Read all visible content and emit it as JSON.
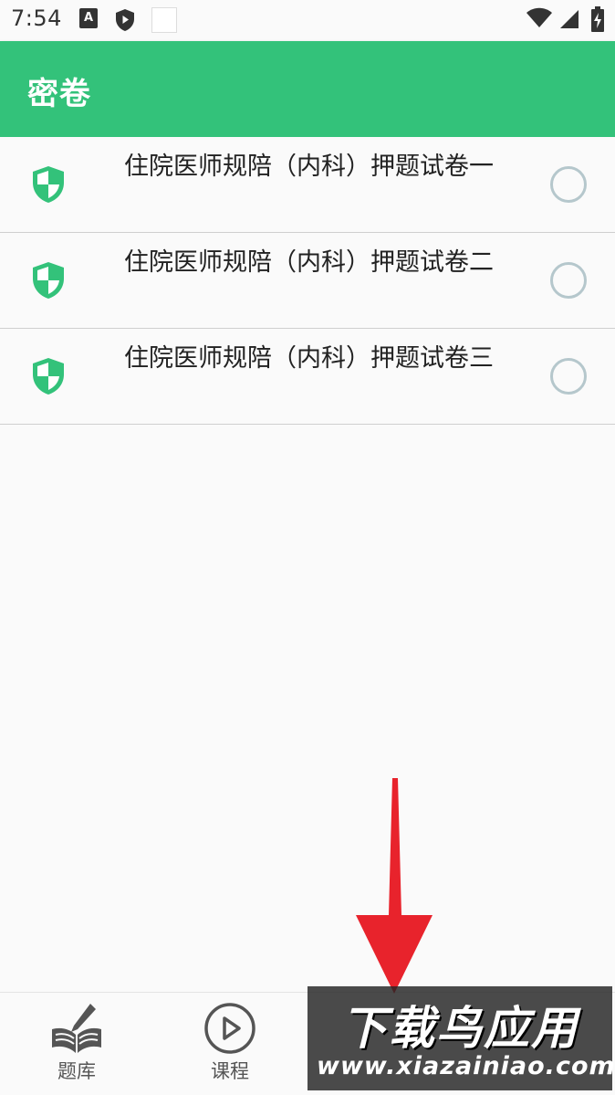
{
  "status_bar": {
    "time": "7:54",
    "a_badge": "A"
  },
  "app_bar": {
    "title": "密卷"
  },
  "papers": [
    {
      "title": "住院医师规陪（内科）押题试卷一",
      "icon": "shield-icon",
      "selected": false
    },
    {
      "title": "住院医师规陪（内科）押题试卷二",
      "icon": "shield-icon",
      "selected": false
    },
    {
      "title": "住院医师规陪（内科）押题试卷三",
      "icon": "shield-icon",
      "selected": false
    }
  ],
  "bottom_nav": {
    "items": [
      {
        "label": "题库",
        "icon": "book-pencil-icon"
      },
      {
        "label": "课程",
        "icon": "play-circle-icon"
      }
    ]
  },
  "watermark": {
    "title": "下载鸟应用",
    "url": "www.xiazainiao.com"
  },
  "colors": {
    "accent": "#33c27a",
    "radio": "#b5c7cc",
    "arrow": "#e8232c"
  }
}
